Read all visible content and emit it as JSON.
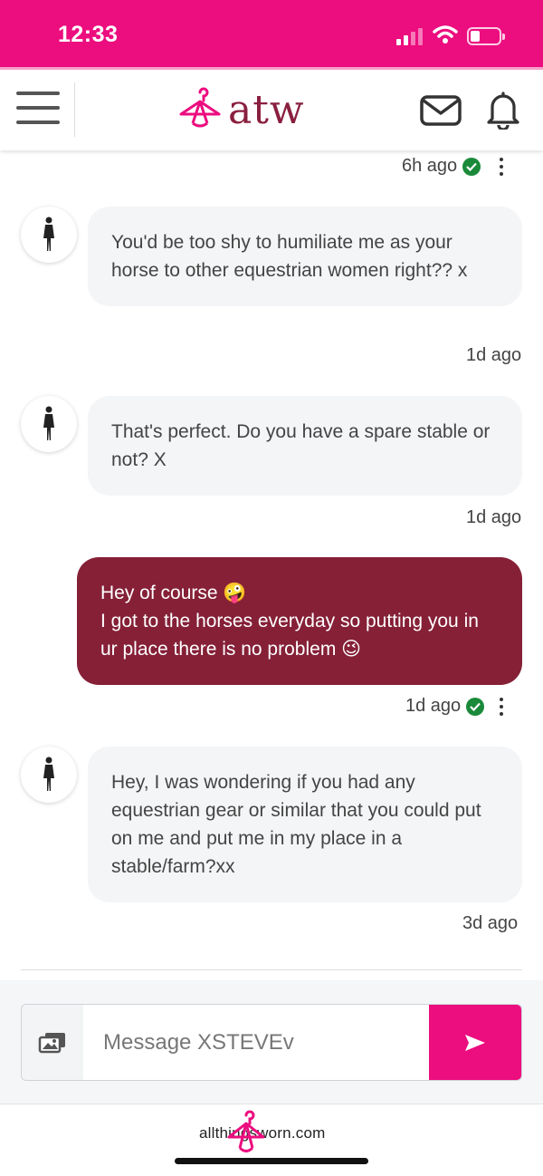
{
  "status_bar": {
    "time": "12:33"
  },
  "header": {
    "brand": "atw",
    "icons": [
      "menu-icon",
      "hanger-logo-icon",
      "mail-icon",
      "bell-icon"
    ]
  },
  "conversation": {
    "top_meta": {
      "time": "6h ago"
    },
    "messages": [
      {
        "direction": "in",
        "text": "You'd be too shy to humiliate me as your horse to other equestrian women right?? x",
        "time": "1d ago"
      },
      {
        "direction": "in",
        "text": "That's perfect. Do you have a spare stable or not? X",
        "time": "1d ago"
      },
      {
        "direction": "out",
        "text": "Hey of course 🤪\nI got to the horses everyday so putting you in ur place there is no problem 😉",
        "time": "1d ago"
      },
      {
        "direction": "in",
        "text": "Hey, I was wondering if you had any equestrian gear or similar that you could put on me and put me in my place in a stable/farm?xx",
        "time": "3d ago"
      }
    ]
  },
  "composer": {
    "placeholder": "Message XSTEVEv",
    "value": ""
  },
  "footer": {
    "text": "allthingsworn.com"
  },
  "colors": {
    "brand_pink": "#ec0d7f",
    "brand_maroon": "#852037",
    "logo_maroon": "#8a1f3f",
    "verified_green": "#1a8a3a"
  }
}
